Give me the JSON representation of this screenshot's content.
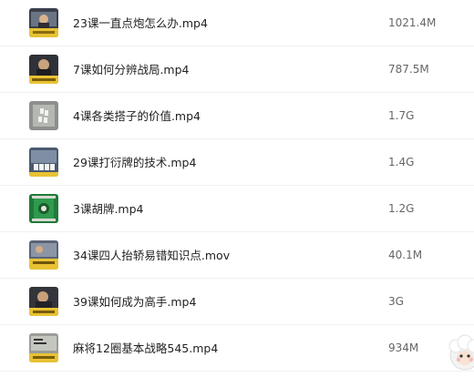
{
  "files": [
    {
      "name": "23课一直点炮怎么办.mp4",
      "size": "1021.4M",
      "thumb": "video-thumbnail-icon"
    },
    {
      "name": "7课如何分辨战局.mp4",
      "size": "787.5M",
      "thumb": "video-thumbnail-icon"
    },
    {
      "name": "4课各类搭子的价值.mp4",
      "size": "1.7G",
      "thumb": "video-thumbnail-icon"
    },
    {
      "name": "29课打衍牌的技术.mp4",
      "size": "1.4G",
      "thumb": "video-thumbnail-icon"
    },
    {
      "name": "3课胡牌.mp4",
      "size": "1.2G",
      "thumb": "video-thumbnail-icon"
    },
    {
      "name": "34课四人抬轿易错知识点.mov",
      "size": "40.1M",
      "thumb": "video-thumbnail-icon"
    },
    {
      "name": "39课如何成为高手.mp4",
      "size": "3G",
      "thumb": "video-thumbnail-icon"
    },
    {
      "name": "麻将12圈基本战略545.mp4",
      "size": "934M",
      "thumb": "video-thumbnail-icon"
    }
  ],
  "colors": {
    "accent_yellow": "#e8c233",
    "mahjong_green": "#1f7a3a",
    "text": "#222222",
    "muted": "#666666"
  },
  "mascot": "sheep-mascot-icon"
}
